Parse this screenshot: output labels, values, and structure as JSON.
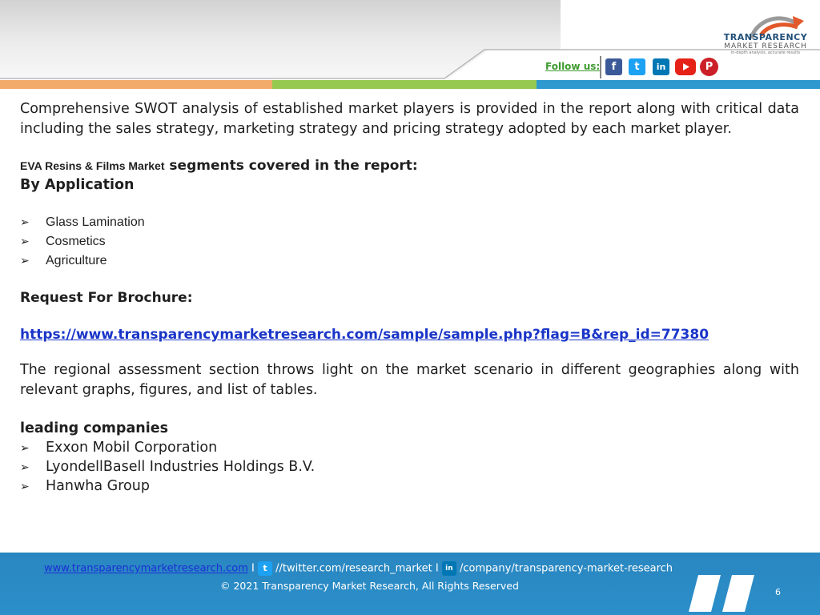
{
  "header": {
    "follow_label": "Follow us:",
    "social_icons": [
      "facebook-icon",
      "twitter-icon",
      "linkedin-icon",
      "youtube-icon",
      "pinterest-icon"
    ],
    "logo": {
      "line1": "TRANSPARENCY",
      "line2": "MARKET RESEARCH",
      "tagline": "in-depth analysis, accurate results"
    },
    "bar_colors": [
      "#f2ab6b",
      "#96c94f",
      "#2d99cf"
    ]
  },
  "content": {
    "intro": "Comprehensive SWOT analysis of established market players is provided in the report along with critical data including the sales strategy, marketing strategy and pricing strategy adopted by each market player.",
    "segments_prefix": "EVA Resins & Films Market",
    "segments_suffix": " segments covered in the report:",
    "by_application": "By Application",
    "applications": [
      "Glass Lamination",
      "Cosmetics",
      "Agriculture"
    ],
    "request_label": "Request For Brochure:",
    "brochure_url": "https://www.transparencymarketresearch.com/sample/sample.php?flag=B&rep_id=77380",
    "regional": "The regional assessment section throws light on the market scenario in different geographies along with relevant graphs, figures, and list of tables.",
    "leading_title": "leading companies",
    "companies": [
      "Exxon Mobil Corporation",
      "LyondellBasell Industries Holdings B.V.",
      "Hanwha Group"
    ]
  },
  "footer": {
    "website": "www.transparencymarketresearch.com",
    "sep": "I",
    "twitter": "//twitter.com/research_market",
    "linkedin": "/company/transparency-market-research",
    "copyright": "© 2021 Transparency Market Research, All Rights Reserved",
    "page_number": "6"
  }
}
